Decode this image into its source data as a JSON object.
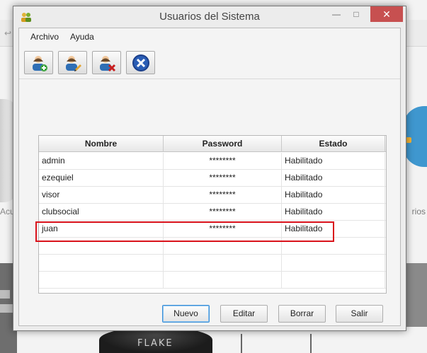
{
  "window": {
    "title": "Usuarios del Sistema"
  },
  "menu": {
    "items": [
      "Archivo",
      "Ayuda"
    ]
  },
  "toolbar": {
    "buttons": [
      {
        "icon": "add-user-icon"
      },
      {
        "icon": "edit-user-icon"
      },
      {
        "icon": "delete-user-icon"
      },
      {
        "icon": "close-x-icon"
      }
    ]
  },
  "table": {
    "headers": [
      "Nombre",
      "Password",
      "Estado"
    ],
    "rows": [
      [
        "admin",
        "********",
        "Habilitado"
      ],
      [
        "ezequiel",
        "********",
        "Habilitado"
      ],
      [
        "visor",
        "********",
        "Habilitado"
      ],
      [
        "clubsocial",
        "********",
        "Habilitado"
      ],
      [
        "juan",
        "********",
        "Habilitado"
      ]
    ],
    "highlighted_row": "juan",
    "highlight_color": "#d9121b"
  },
  "actions": {
    "nuevo": "Nuevo",
    "editar": "Editar",
    "borrar": "Borrar",
    "salir": "Salir"
  },
  "background": {
    "left_label": "Acu",
    "right_label": "rios",
    "device_text": "FLAKE"
  }
}
